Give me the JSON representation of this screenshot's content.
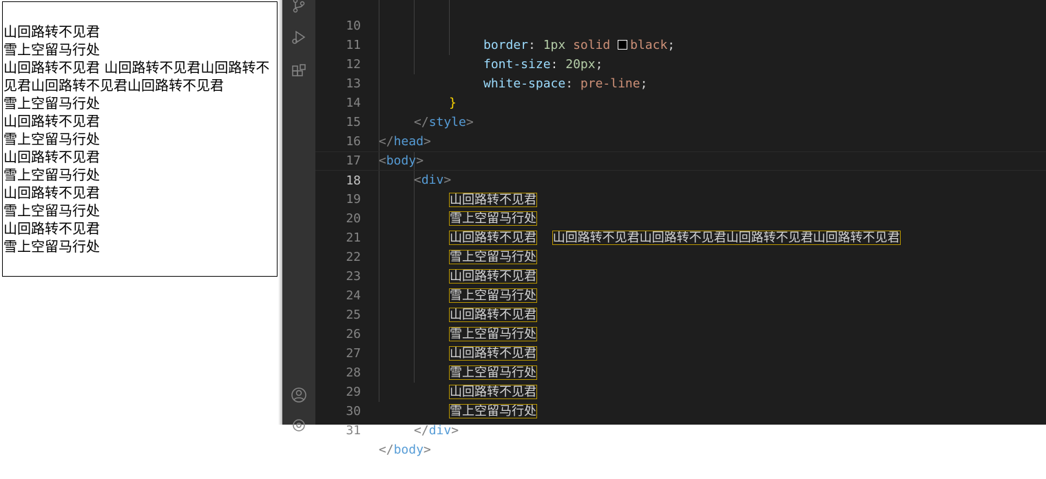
{
  "preview": {
    "lines": [
      "山回路转不见君",
      "雪上空留马行处",
      "山回路转不见君 山回路转不见君山回路转不见君山回路转不见君山回路转不见君",
      "雪上空留马行处",
      "山回路转不见君",
      "雪上空留马行处",
      "山回路转不见君",
      "雪上空留马行处",
      "山回路转不见君",
      "雪上空留马行处",
      "山回路转不见君",
      "雪上空留马行处"
    ]
  },
  "activity_bar": {
    "icons": [
      "source-control-icon",
      "run-debug-icon",
      "extensions-icon",
      "account-icon",
      "settings-icon"
    ]
  },
  "editor": {
    "active_line": "18",
    "lines": [
      {
        "n": "10",
        "text_a": "border",
        "text_b": ":",
        "text_c": "1px",
        "text_d": "solid",
        "text_e": "black",
        "text_f": ";"
      },
      {
        "n": "11",
        "prop": "font-size",
        "colon": ":",
        "value": "20px",
        "semi": ";"
      },
      {
        "n": "12",
        "prop": "white-space",
        "colon": ":",
        "value": "pre-line",
        "semi": ";"
      },
      {
        "n": "13",
        "brace": "}"
      },
      {
        "n": "14",
        "open": "</",
        "tag": "style",
        "close": ">"
      },
      {
        "n": "15",
        "open": "</",
        "tag": "head",
        "close": ">"
      },
      {
        "n": "16",
        "open": "<",
        "tag": "body",
        "close": ">"
      },
      {
        "n": "17",
        "open": "<",
        "tag": "div",
        "close": ">"
      },
      {
        "n": "18",
        "text": "山回路转不见君"
      },
      {
        "n": "19",
        "text": "雪上空留马行处"
      },
      {
        "n": "20",
        "text": "山回路转不见君",
        "text2": "山回路转不见君山回路转不见君山回路转不见君山回路转不见君"
      },
      {
        "n": "21",
        "text": "雪上空留马行处"
      },
      {
        "n": "22",
        "text": "山回路转不见君"
      },
      {
        "n": "23",
        "text": "雪上空留马行处"
      },
      {
        "n": "24",
        "text": "山回路转不见君"
      },
      {
        "n": "25",
        "text": "雪上空留马行处"
      },
      {
        "n": "26",
        "text": "山回路转不见君"
      },
      {
        "n": "27",
        "text": "雪上空留马行处"
      },
      {
        "n": "28",
        "text": "山回路转不见君"
      },
      {
        "n": "29",
        "text": "雪上空留马行处"
      },
      {
        "n": "30",
        "open": "</",
        "tag": "div",
        "close": ">"
      },
      {
        "n": "31",
        "open": "</",
        "tag": "body",
        "close": ">"
      }
    ]
  },
  "colors": {
    "editor_bg": "#1e1e1e",
    "tag": "#569cd6",
    "property": "#9cdcfe",
    "value": "#ce9178",
    "number": "#b5cea8",
    "highlight_border": "#b89500"
  }
}
